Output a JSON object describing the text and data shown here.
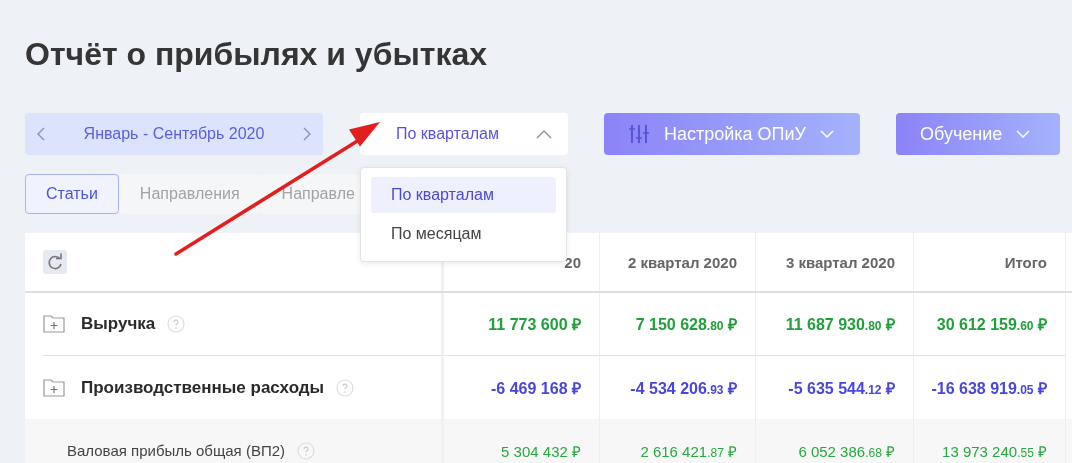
{
  "title": "Отчёт о прибылях и убытках",
  "period": {
    "label": "Январь - Сентябрь 2020"
  },
  "grouping": {
    "value": "По кварталам",
    "expanded": true,
    "options": [
      {
        "label": "По кварталам",
        "selected": true
      },
      {
        "label": "По месяцам",
        "selected": false
      }
    ]
  },
  "buttons": [
    {
      "kind": "settings",
      "label": "Настройка ОПиУ"
    },
    {
      "kind": "menu",
      "label": "Обучение"
    }
  ],
  "tabs": [
    {
      "label": "Статьи",
      "selected": true
    },
    {
      "label": "Направления",
      "selected": false
    },
    {
      "label": "Направле",
      "selected": false
    }
  ],
  "table": {
    "columns": [
      "20",
      "2 квартал 2020",
      "3 квартал 2020",
      "Итого"
    ],
    "rows": [
      {
        "kind": "group",
        "name": "Выручка",
        "color": "#1fa03a",
        "values": [
          {
            "amount": "11 773 600",
            "currency": "₽"
          },
          {
            "amount": "7 150 628",
            "cents": ".80",
            "currency": "₽"
          },
          {
            "amount": "11 687 930",
            "cents": ".80",
            "currency": "₽"
          },
          {
            "amount": "30 612 159",
            "cents": ".60",
            "currency": "₽"
          }
        ]
      },
      {
        "kind": "group",
        "name": "Производственные расходы",
        "color": "#4a45dc",
        "values": [
          {
            "amount": "-6 469 168",
            "currency": "₽"
          },
          {
            "amount": "-4 534 206",
            "cents": ".93",
            "currency": "₽"
          },
          {
            "amount": "-5 635 544",
            "cents": ".12",
            "currency": "₽"
          },
          {
            "amount": "-16 638 919",
            "cents": ".05",
            "currency": "₽"
          }
        ]
      },
      {
        "kind": "subtotal",
        "name": "Валовая прибыль общая (ВП2)",
        "color": "#27a83f",
        "values": [
          {
            "amount": "5 304 432",
            "currency": "₽"
          },
          {
            "amount": "2 616 421",
            "cents": ".87",
            "currency": "₽"
          },
          {
            "amount": "6 052 386",
            "cents": ".68",
            "currency": "₽"
          },
          {
            "amount": "13 973 240",
            "cents": ".55",
            "currency": "₽"
          }
        ]
      }
    ]
  }
}
